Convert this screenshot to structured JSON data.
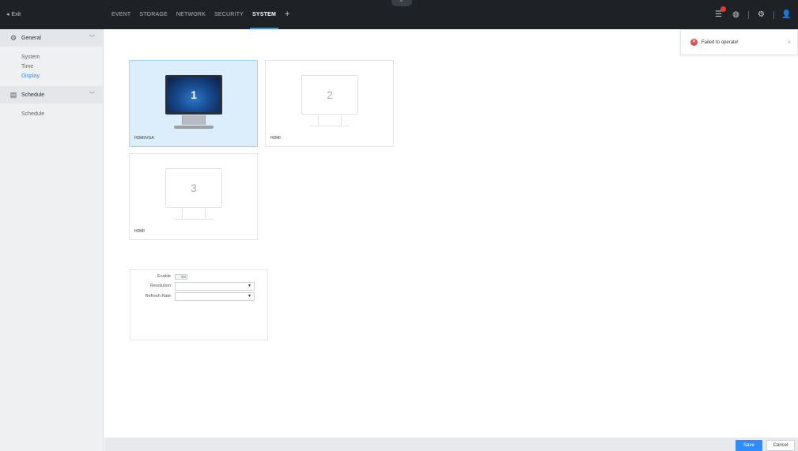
{
  "header": {
    "exit_label": "Exit",
    "tabs": [
      "EVENT",
      "STORAGE",
      "NETWORK",
      "SECURITY",
      "SYSTEM",
      "+"
    ],
    "active_tab": "SYSTEM",
    "icons": [
      "list-icon",
      "globe-icon",
      "gear-icon",
      "user-icon"
    ]
  },
  "sidebar": {
    "groups": [
      {
        "label": "General",
        "icon": "gear-icon",
        "items": [
          "System",
          "Time",
          "Display"
        ],
        "active_item": "Display"
      },
      {
        "label": "Schedule",
        "icon": "calendar-icon",
        "items": [
          "Schedule"
        ]
      }
    ]
  },
  "monitors": [
    {
      "number": "1",
      "label": "HDMI/VGA",
      "selected": true
    },
    {
      "number": "2",
      "label": "HDMI",
      "selected": false
    },
    {
      "number": "3",
      "label": "HDMI",
      "selected": false
    }
  ],
  "config": {
    "enable_label": "Enable",
    "resolution_label": "Resolution",
    "refresh_rate_label": "Refresh Rate",
    "resolution_value": "",
    "refresh_rate_value": ""
  },
  "toast": {
    "message": "Failed to operate!"
  },
  "footer": {
    "save_label": "Save",
    "cancel_label": "Cancel"
  },
  "colors": {
    "accent": "#2f8cff",
    "topbar": "#1e2126",
    "error": "#e64c4c",
    "selected_bg": "#dceefc"
  }
}
